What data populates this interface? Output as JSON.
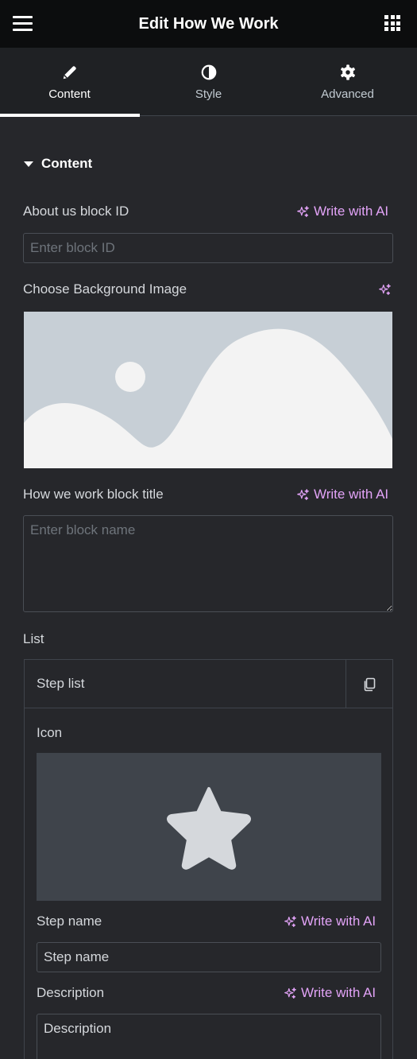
{
  "header": {
    "title": "Edit How We Work",
    "menu_icon": "hamburger-icon",
    "apps_icon": "grid-icon"
  },
  "tabs": [
    {
      "label": "Content",
      "icon": "pencil-icon",
      "active": true
    },
    {
      "label": "Style",
      "icon": "half-circle-icon",
      "active": false
    },
    {
      "label": "Advanced",
      "icon": "gear-icon",
      "active": false
    }
  ],
  "section": {
    "title": "Content"
  },
  "fields": {
    "block_id": {
      "label": "About us block ID",
      "ai_label": "Write with AI",
      "placeholder": "Enter block ID",
      "value": ""
    },
    "bg_image": {
      "label": "Choose Background Image",
      "ai_icon": "sparkle-icon"
    },
    "block_title": {
      "label": "How we work block title",
      "ai_label": "Write with AI",
      "placeholder": "Enter block name",
      "value": ""
    },
    "list": {
      "label": "List"
    }
  },
  "repeater": {
    "item_title": "Step list",
    "duplicate_icon": "copy-icon",
    "icon_label": "Icon",
    "icon_preview": "star-icon",
    "step_name": {
      "label": "Step name",
      "ai_label": "Write with AI",
      "value": "Step name"
    },
    "description": {
      "label": "Description",
      "ai_label": "Write with AI",
      "value": "Description"
    }
  },
  "colors": {
    "accent_ai": "#e2a3f7",
    "panel_bg": "#26272b",
    "header_bg": "#0c0d0e"
  }
}
